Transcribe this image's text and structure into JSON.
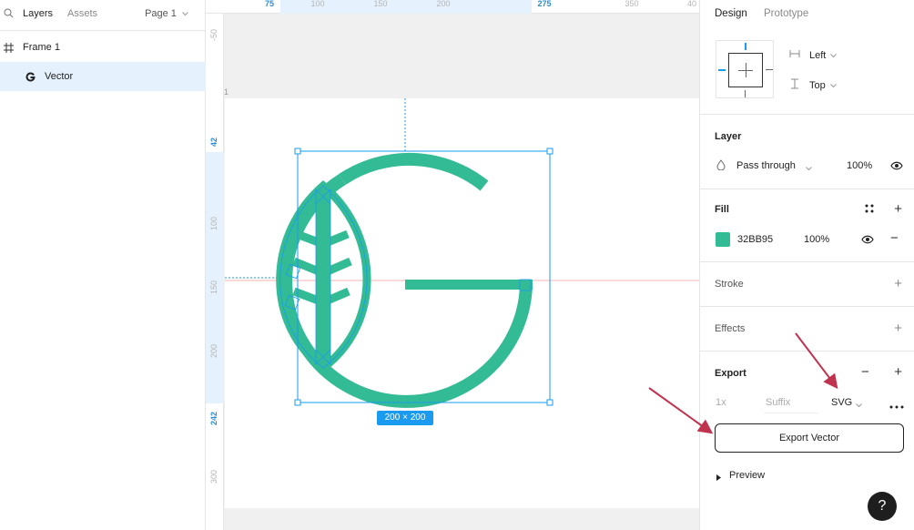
{
  "left_panel": {
    "tabs": [
      "Layers",
      "Assets"
    ],
    "page": "Page 1",
    "layers": [
      {
        "name": "Frame 1",
        "icon": "frame-hash-icon"
      },
      {
        "name": "Vector",
        "icon": "vector-g-icon"
      }
    ]
  },
  "canvas": {
    "ruler_top_ticks": [
      "75",
      "100",
      "150",
      "200",
      "275",
      "350",
      "40"
    ],
    "ruler_left_ticks": [
      "-50",
      "42",
      "100",
      "150",
      "200",
      "242",
      "300"
    ],
    "frame_label": "1",
    "selection_size": "200 × 200",
    "logo_color": "#32BB95",
    "selection_color": "#1a9bf0"
  },
  "right_panel": {
    "tabs": [
      "Design",
      "Prototype"
    ],
    "constraints": {
      "horizontal": "Left",
      "vertical": "Top"
    },
    "layer": {
      "title": "Layer",
      "blend": "Pass through",
      "opacity": "100%"
    },
    "fill": {
      "title": "Fill",
      "hex": "32BB95",
      "opacity": "100%",
      "color": "#32BB95"
    },
    "stroke": {
      "title": "Stroke"
    },
    "effects": {
      "title": "Effects"
    },
    "export": {
      "title": "Export",
      "scale": "1x",
      "suffix_placeholder": "Suffix",
      "format": "SVG",
      "button": "Export Vector",
      "preview": "Preview"
    },
    "help": "?"
  },
  "annotation_color": "#c0334f"
}
